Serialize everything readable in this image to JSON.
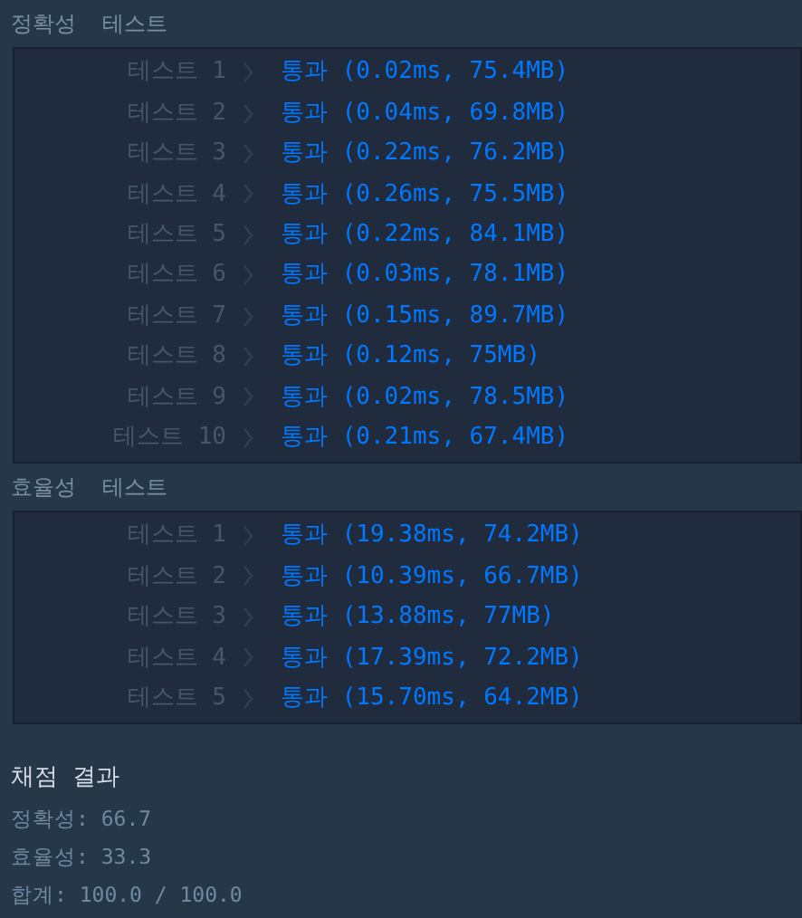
{
  "sections": [
    {
      "title": "정확성  테스트",
      "rows": [
        {
          "label": "테스트 1",
          "result": "통과 (0.02ms, 75.4MB)"
        },
        {
          "label": "테스트 2",
          "result": "통과 (0.04ms, 69.8MB)"
        },
        {
          "label": "테스트 3",
          "result": "통과 (0.22ms, 76.2MB)"
        },
        {
          "label": "테스트 4",
          "result": "통과 (0.26ms, 75.5MB)"
        },
        {
          "label": "테스트 5",
          "result": "통과 (0.22ms, 84.1MB)"
        },
        {
          "label": "테스트 6",
          "result": "통과 (0.03ms, 78.1MB)"
        },
        {
          "label": "테스트 7",
          "result": "통과 (0.15ms, 89.7MB)"
        },
        {
          "label": "테스트 8",
          "result": "통과 (0.12ms, 75MB)"
        },
        {
          "label": "테스트 9",
          "result": "통과 (0.02ms, 78.5MB)"
        },
        {
          "label": "테스트 10",
          "result": "통과 (0.21ms, 67.4MB)"
        }
      ]
    },
    {
      "title": "효율성  테스트",
      "rows": [
        {
          "label": "테스트 1",
          "result": "통과 (19.38ms, 74.2MB)"
        },
        {
          "label": "테스트 2",
          "result": "통과 (10.39ms, 66.7MB)"
        },
        {
          "label": "테스트 3",
          "result": "통과 (13.88ms, 77MB)"
        },
        {
          "label": "테스트 4",
          "result": "통과 (17.39ms, 72.2MB)"
        },
        {
          "label": "테스트 5",
          "result": "통과 (15.70ms, 64.2MB)"
        }
      ]
    }
  ],
  "summary": {
    "title": "채점 결과",
    "lines": [
      "정확성: 66.7",
      "효율성: 33.3",
      "합계: 100.0 / 100.0"
    ]
  }
}
